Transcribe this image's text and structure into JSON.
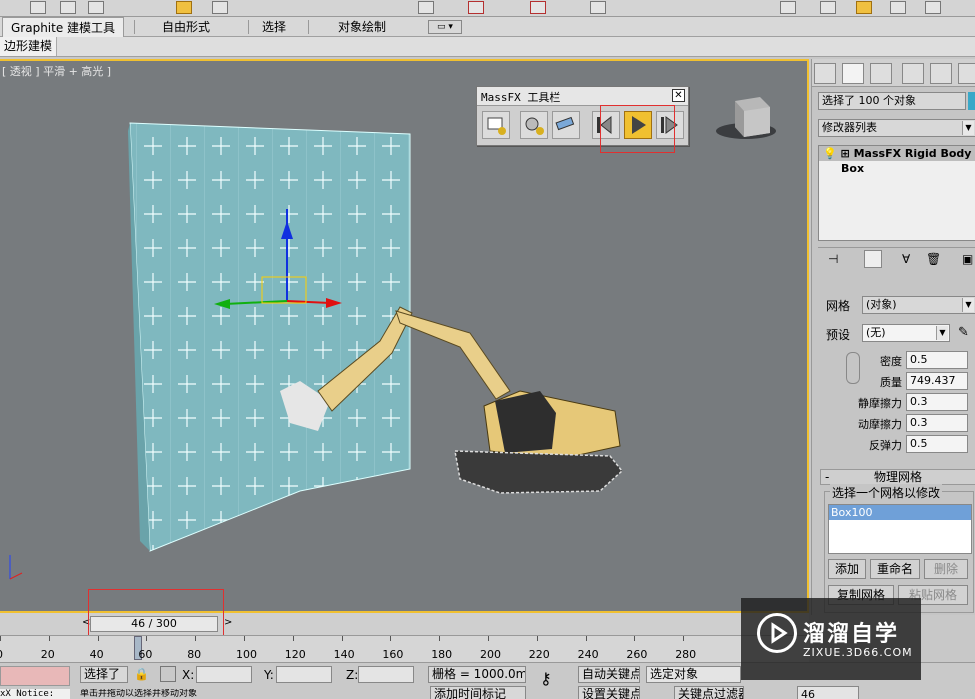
{
  "ribbon": {
    "tabs": [
      "Graphite 建模工具",
      "自由形式",
      "选择",
      "对象绘制"
    ],
    "sub_panel": "边形建模"
  },
  "viewport": {
    "label": "[ 透视 ] 平滑 + 高光 ]"
  },
  "massfx_toolbar": {
    "title": "MassFX 工具栏",
    "close": "✕"
  },
  "command_panel": {
    "selection_field": "选择了 100 个对象",
    "modifier_list": "修改器列表",
    "stack": [
      "MassFX Rigid Body",
      "Box"
    ],
    "mesh_label": "网格",
    "mesh_value": "(对象)",
    "preset_label": "预设",
    "preset_value": "(无)",
    "density_label": "密度",
    "density_value": "0.5",
    "mass_label": "质量",
    "mass_value": "749.437",
    "static_friction_label": "静摩擦力",
    "static_friction_value": "0.3",
    "dynamic_friction_label": "动摩擦力",
    "dynamic_friction_value": "0.3",
    "bounce_label": "反弹力",
    "bounce_value": "0.5",
    "physical_mesh_title": "物理网格",
    "select_mesh_group": "选择一个网格以修改",
    "mesh_list": [
      "Box100"
    ],
    "btn_add": "添加",
    "btn_rename": "重命名",
    "btn_delete": "删除",
    "btn_copy_mesh": "复制网格",
    "btn_paste_mesh": "粘贴网格"
  },
  "timeline": {
    "slider_text": "46 / 300",
    "current_frame": 46,
    "total_frames": 300,
    "ticks": [
      "0",
      "20",
      "40",
      "60",
      "80",
      "100",
      "120",
      "140",
      "160",
      "180",
      "200",
      "220",
      "240",
      "260",
      "280"
    ]
  },
  "status": {
    "selected": "选择了",
    "x_label": "X:",
    "y_label": "Y:",
    "z_label": "Z:",
    "grid": "栅格 = 1000.0mm",
    "auto_key": "自动关键点",
    "selected_object": "选定对象",
    "set_key": "设置关键点",
    "key_filter": "关键点过滤器",
    "add_time_tag": "添加时间标记",
    "frame_field": "46",
    "notice": "xX Notice:",
    "prompt": "单击并拖动以选择并移动对象"
  },
  "watermark": {
    "name": "溜溜自学",
    "url": "ZIXUE.3D66.COM"
  }
}
